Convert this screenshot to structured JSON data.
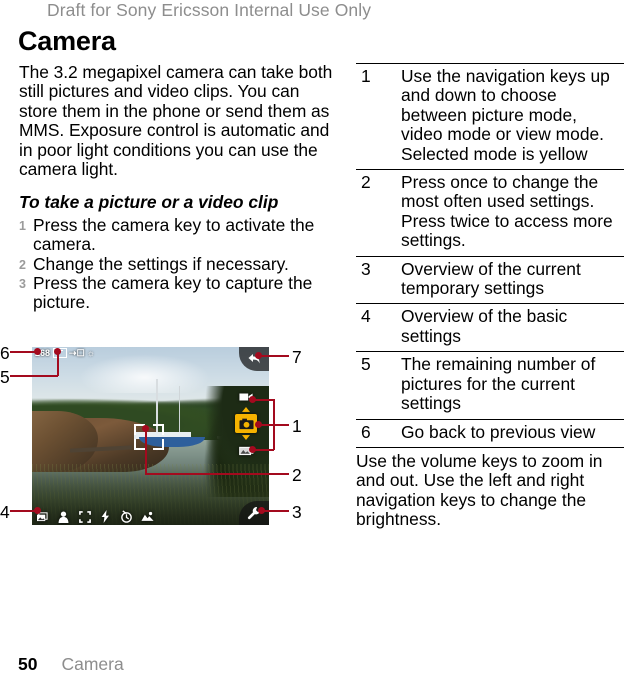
{
  "header": {
    "draft_notice": "Draft for Sony Ericsson Internal Use Only"
  },
  "chapter": {
    "title": "Camera"
  },
  "left_column": {
    "intro_paragraph": "The 3.2 megapixel camera can take both still pictures and video clips. You can store them in the phone or send them as MMS. Exposure control is automatic and in poor light conditions you can use the camera light.",
    "subheading": "To take a picture or a video clip",
    "steps": [
      "Press the camera key to activate the camera.",
      "Change the settings if necessary.",
      "Press the camera key to capture the picture."
    ]
  },
  "reference_table": {
    "rows": [
      {
        "num": "1",
        "desc": "Use the navigation keys up and down to choose between picture mode, video mode or view mode. Selected mode is yellow"
      },
      {
        "num": "2",
        "desc": "Press once to change the most often used settings. Press twice to access more settings."
      },
      {
        "num": "3",
        "desc": "Overview of the current temporary settings"
      },
      {
        "num": "4",
        "desc": "Overview of the basic settings"
      },
      {
        "num": "5",
        "desc": "The remaining number of pictures for the current settings"
      },
      {
        "num": "6",
        "desc": "Go back to previous view"
      }
    ],
    "footnote": "Use the volume keys to zoom in and out. Use the left and right navigation keys to change the brightness."
  },
  "figure": {
    "callouts": {
      "c1": "1",
      "c2": "2",
      "c3": "3",
      "c4": "4",
      "c5": "5",
      "c6": "6",
      "c7": "7"
    },
    "camera_ui": {
      "remaining_pictures": "268",
      "resolution_label": "3MP",
      "storage_icon": "memory-card-icon",
      "shake_icon": "steady-shot-icon",
      "back_icon": "back-arrow-icon",
      "settings_icon": "wrench-icon",
      "mode_video": "video-mode-icon",
      "mode_picture": "picture-mode-icon",
      "mode_view": "view-mode-icon",
      "selected_mode": "picture",
      "selected_mode_color": "#f5b300",
      "bottom_icons": [
        "shoot-mode-icon",
        "portrait-icon",
        "focus-icon",
        "flash-icon",
        "self-timer-icon",
        "scenes-icon"
      ]
    }
  },
  "footer": {
    "page_number": "50",
    "section": "Camera"
  }
}
